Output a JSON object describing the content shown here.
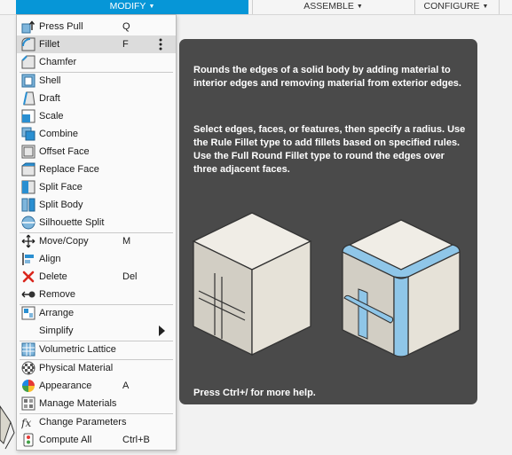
{
  "toolbar": {
    "tabs": [
      {
        "label": "MODIFY"
      },
      {
        "label": "ASSEMBLE"
      },
      {
        "label": "CONFIGURE"
      }
    ]
  },
  "menu": {
    "items": [
      {
        "label": "Press Pull",
        "shortcut": "Q",
        "icon": "press-pull-icon"
      },
      {
        "label": "Fillet",
        "shortcut": "F",
        "icon": "fillet-icon"
      },
      {
        "label": "Chamfer",
        "shortcut": "",
        "icon": "chamfer-icon"
      },
      {
        "label": "Shell",
        "shortcut": "",
        "icon": "shell-icon"
      },
      {
        "label": "Draft",
        "shortcut": "",
        "icon": "draft-icon"
      },
      {
        "label": "Scale",
        "shortcut": "",
        "icon": "scale-icon"
      },
      {
        "label": "Combine",
        "shortcut": "",
        "icon": "combine-icon"
      },
      {
        "label": "Offset Face",
        "shortcut": "",
        "icon": "offset-face-icon"
      },
      {
        "label": "Replace Face",
        "shortcut": "",
        "icon": "replace-face-icon"
      },
      {
        "label": "Split Face",
        "shortcut": "",
        "icon": "split-face-icon"
      },
      {
        "label": "Split Body",
        "shortcut": "",
        "icon": "split-body-icon"
      },
      {
        "label": "Silhouette Split",
        "shortcut": "",
        "icon": "silhouette-split-icon"
      },
      {
        "label": "Move/Copy",
        "shortcut": "M",
        "icon": "move-copy-icon"
      },
      {
        "label": "Align",
        "shortcut": "",
        "icon": "align-icon"
      },
      {
        "label": "Delete",
        "shortcut": "Del",
        "icon": "delete-icon"
      },
      {
        "label": "Remove",
        "shortcut": "",
        "icon": "remove-icon"
      },
      {
        "label": "Arrange",
        "shortcut": "",
        "icon": "arrange-icon"
      },
      {
        "label": "Simplify",
        "shortcut": "",
        "icon": ""
      },
      {
        "label": "Volumetric Lattice",
        "shortcut": "",
        "icon": "volumetric-lattice-icon"
      },
      {
        "label": "Physical Material",
        "shortcut": "",
        "icon": "physical-material-icon"
      },
      {
        "label": "Appearance",
        "shortcut": "A",
        "icon": "appearance-icon"
      },
      {
        "label": "Manage Materials",
        "shortcut": "",
        "icon": "manage-materials-icon"
      },
      {
        "label": "Change Parameters",
        "shortcut": "",
        "icon": "change-parameters-icon"
      },
      {
        "label": "Compute All",
        "shortcut": "Ctrl+B",
        "icon": "compute-all-icon"
      }
    ]
  },
  "tooltip": {
    "description": "Rounds the edges of a solid body by adding material to interior edges and removing material from exterior edges.",
    "instructions": "Select edges, faces, or features, then specify a radius. Use the Rule Fillet type to add fillets based on specified rules. Use the Full Round Fillet type to round the edges over three adjacent faces.",
    "footer": "Press Ctrl+/ for more help."
  },
  "colors": {
    "accent": "#0696d7",
    "tooltip_bg": "#4a4a4a",
    "highlight": "#dcdcdc",
    "fillet_blue": "#8fc6e8"
  }
}
